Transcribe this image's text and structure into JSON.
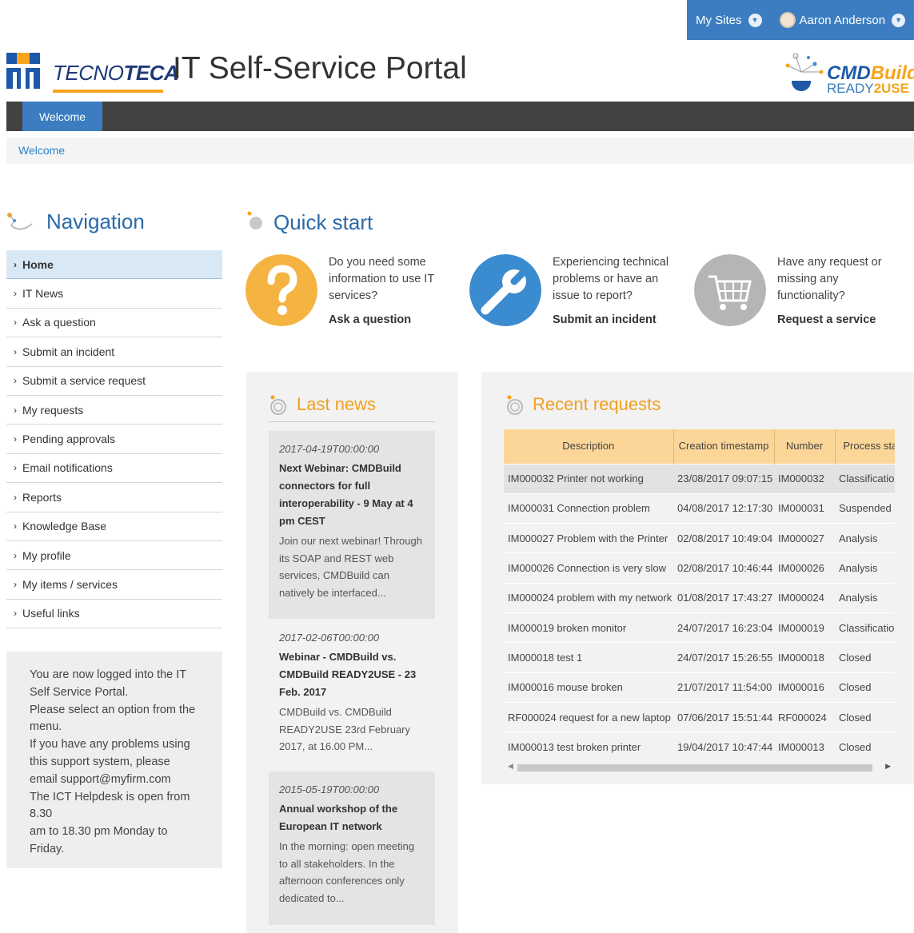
{
  "topbar": {
    "my_sites": "My Sites",
    "user_name": "Aaron Anderson"
  },
  "header": {
    "brand_prefix": "TECNO",
    "brand_suffix": "TECA",
    "title": "IT Self-Service Portal",
    "cmdb_logo_line1_a": "CMD",
    "cmdb_logo_line1_b": "Build",
    "cmdb_logo_line2_a": "READY",
    "cmdb_logo_line2_b": "2USE"
  },
  "navbar": {
    "tab_welcome": "Welcome"
  },
  "breadcrumb": {
    "current": "Welcome"
  },
  "sidebar": {
    "title": "Navigation",
    "items": [
      {
        "label": "Home",
        "active": true
      },
      {
        "label": "IT News"
      },
      {
        "label": "Ask a question"
      },
      {
        "label": "Submit an incident"
      },
      {
        "label": "Submit a service request"
      },
      {
        "label": "My requests"
      },
      {
        "label": "Pending approvals"
      },
      {
        "label": "Email notifications"
      },
      {
        "label": "Reports"
      },
      {
        "label": "Knowledge Base"
      },
      {
        "label": "My profile"
      },
      {
        "label": "My items / services"
      },
      {
        "label": "Useful links"
      }
    ],
    "info_lines": [
      "You are now logged into the IT",
      "Self Service Portal.",
      "Please select an option from the",
      "menu.",
      "If you have any problems using",
      "this support system, please",
      "email support@myfirm.com",
      "The ICT Helpdesk is open from",
      "8.30",
      "am to 18.30 pm Monday to",
      "Friday."
    ]
  },
  "quick_start": {
    "title": "Quick start",
    "items": [
      {
        "icon": "question-icon",
        "color": "#f5b342",
        "lines": [
          "Do you need some",
          "information to use IT",
          "services?"
        ],
        "link": "Ask a question"
      },
      {
        "icon": "wrench-icon",
        "color": "#3b8bd0",
        "lines": [
          "Experiencing technical",
          "problems or have an",
          "issue to report?"
        ],
        "link": "Submit an incident"
      },
      {
        "icon": "cart-icon",
        "color": "#b5b5b5",
        "lines": [
          "Have any request or",
          "missing any",
          "functionality?"
        ],
        "link": "Request a service"
      }
    ]
  },
  "news": {
    "title": "Last news",
    "items": [
      {
        "date": "2017-04-19T00:00:00",
        "title_lines": [
          "Next Webinar: CMDBuild",
          "connectors for full",
          "interoperability - 9 May at 4",
          "pm CEST"
        ],
        "body_lines": [
          "Join our next webinar! Through",
          "its SOAP and REST web",
          "services, CMDBuild can",
          "natively be interfaced..."
        ]
      },
      {
        "date": "2017-02-06T00:00:00",
        "title_lines": [
          "Webinar - CMDBuild vs.",
          "CMDBuild READY2USE - 23",
          "Feb. 2017"
        ],
        "body_lines": [
          "CMDBuild vs. CMDBuild",
          "READY2USE 23rd February",
          "2017, at 16.00 PM..."
        ]
      },
      {
        "date": "2015-05-19T00:00:00",
        "title_lines": [
          "Annual workshop of the",
          "European IT network"
        ],
        "body_lines": [
          "In the morning: open meeting",
          "to all stakeholders. In the",
          "afternoon conferences only",
          "dedicated to..."
        ]
      }
    ]
  },
  "requests": {
    "title": "Recent requests",
    "columns": [
      "Description",
      "Creation timestamp",
      "Number",
      "Process status"
    ],
    "rows": [
      [
        "IM000032 Printer not working",
        "23/08/2017 09:07:15",
        "IM000032",
        "Classification"
      ],
      [
        "IM000031 Connection problem",
        "04/08/2017 12:17:30",
        "IM000031",
        "Suspended"
      ],
      [
        "IM000027 Problem with the Printer",
        "02/08/2017 10:49:04",
        "IM000027",
        "Analysis"
      ],
      [
        "IM000026 Connection is very slow",
        "02/08/2017 10:46:44",
        "IM000026",
        "Analysis"
      ],
      [
        "IM000024 problem with my network",
        "01/08/2017 17:43:27",
        "IM000024",
        "Analysis"
      ],
      [
        "IM000019 broken monitor",
        "24/07/2017 16:23:04",
        "IM000019",
        "Classification"
      ],
      [
        "IM000018 test 1",
        "24/07/2017 15:26:55",
        "IM000018",
        "Closed"
      ],
      [
        "IM000016 mouse broken",
        "21/07/2017 11:54:00",
        "IM000016",
        "Closed"
      ],
      [
        "RF000024 request for a new laptop",
        "07/06/2017 15:51:44",
        "RF000024",
        "Closed"
      ],
      [
        "IM000013 test broken printer",
        "19/04/2017 10:47:44",
        "IM000013",
        "Closed"
      ]
    ]
  }
}
